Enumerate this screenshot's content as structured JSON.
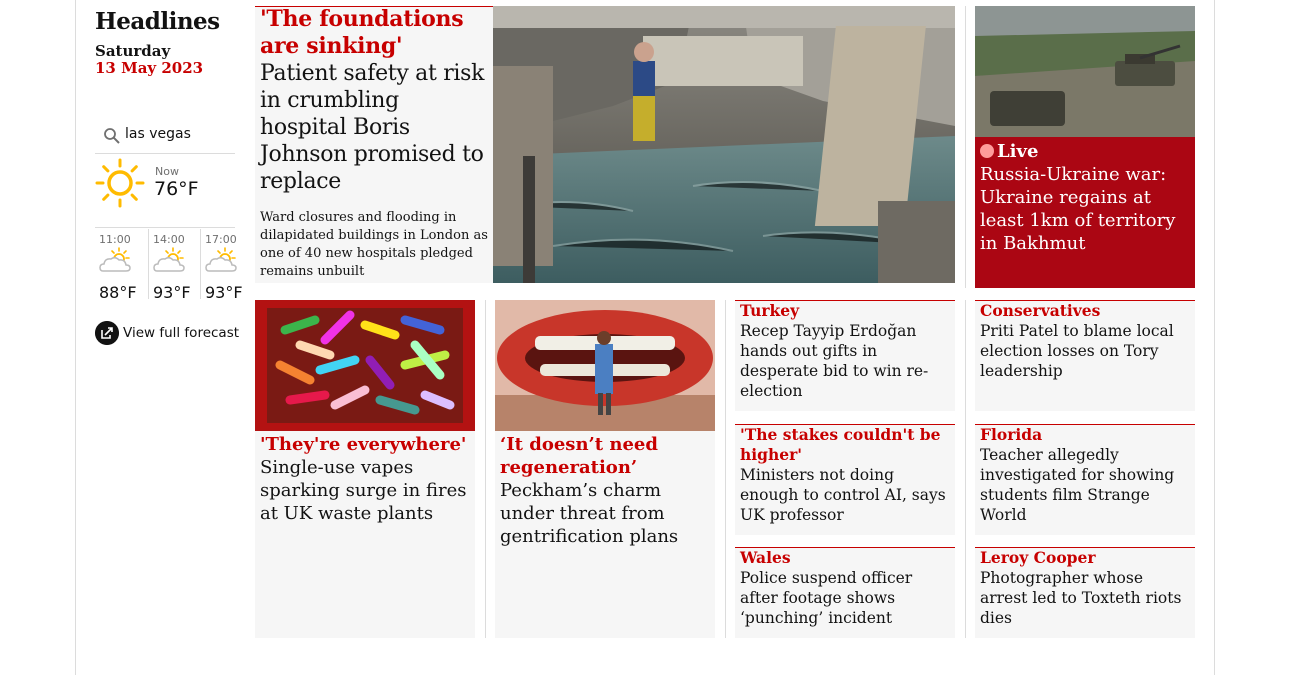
{
  "sidebar": {
    "title": "Headlines",
    "day": "Saturday",
    "date": "13 May 2023",
    "location": "las vegas",
    "now_label": "Now",
    "now_temp": "76°F",
    "forecast": [
      {
        "time": "11:00",
        "temp": "88°F",
        "icon": "partly-cloudy-icon"
      },
      {
        "time": "14:00",
        "temp": "93°F",
        "icon": "partly-cloudy-icon"
      },
      {
        "time": "17:00",
        "temp": "93°F",
        "icon": "partly-cloudy-icon"
      }
    ],
    "forecast_link": "View full forecast"
  },
  "lead": {
    "kicker": "'The foundations are sinking'",
    "headline": "Patient safety at risk in crumbling hospital Boris Johnson promised to replace",
    "standfirst": "Ward closures and flooding in dilapidated buildings in London as one of 40 new hospitals pledged remains unbuilt"
  },
  "live": {
    "label": "Live",
    "headline": "Russia-Ukraine war: Ukraine regains at least 1km of territory in Bakhmut"
  },
  "cards": {
    "vapes": {
      "kicker": "'They're everywhere'",
      "headline": "Single-use vapes sparking surge in fires at UK waste plants"
    },
    "peckham": {
      "kicker": "‘It doesn’t need regeneration’",
      "headline": "Peckham’s charm under threat from gentrification plans"
    },
    "turkey": {
      "kicker": "Turkey",
      "headline": "Recep Tayyip Erdoğan hands out gifts in desperate bid to win re-election"
    },
    "ai": {
      "kicker": "'The stakes couldn't be higher'",
      "headline": "Ministers not doing enough to control AI, says UK professor"
    },
    "wales": {
      "kicker": "Wales",
      "headline": "Police suspend officer after footage shows ‘punching’ incident"
    },
    "conservatives": {
      "kicker": "Conservatives",
      "headline": "Priti Patel to blame local election losses on Tory leadership"
    },
    "florida": {
      "kicker": "Florida",
      "headline": "Teacher allegedly investigated for showing students film Strange World"
    },
    "cooper": {
      "kicker": "Leroy Cooper",
      "headline": "Photographer whose arrest led to Toxteth riots dies"
    }
  },
  "colors": {
    "kicker": "#c70000",
    "live_bg": "#ab0613",
    "card_bg": "#f6f6f6"
  }
}
